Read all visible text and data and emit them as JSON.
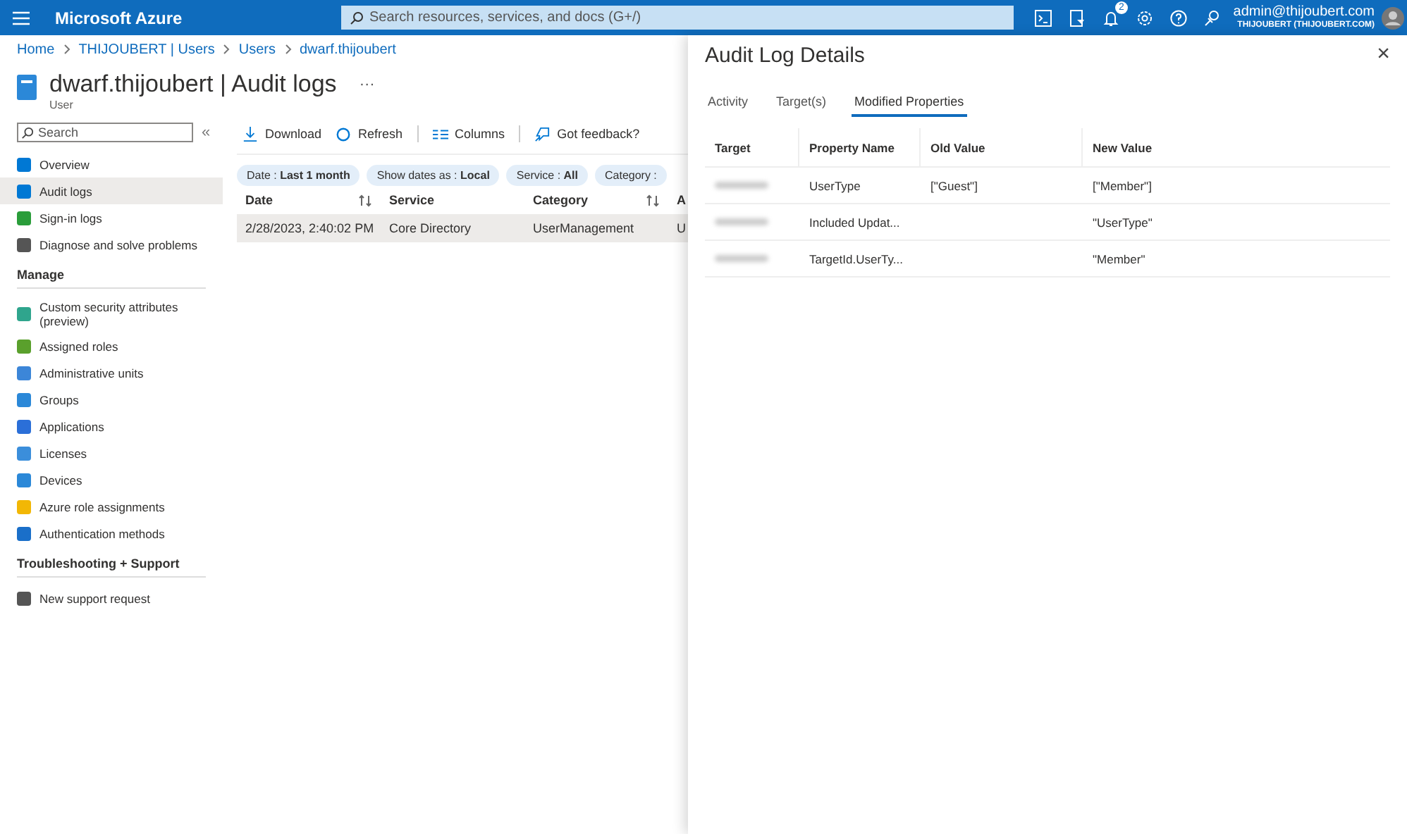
{
  "topbar": {
    "brand": "Microsoft Azure",
    "search": {
      "placeholder": "Search resources, services, and docs (G+/)"
    },
    "notification_count": "2",
    "account": {
      "email": "admin@thijoubert.com",
      "tenant": "THIJOUBERT (THIJOUBERT.COM)"
    }
  },
  "breadcrumb": [
    "Home",
    "THIJOUBERT | Users",
    "Users",
    "dwarf.thijoubert"
  ],
  "page": {
    "title": "dwarf.thijoubert | Audit logs",
    "more": "···",
    "subtitle": "User"
  },
  "sidebar": {
    "search": {
      "placeholder": "Search"
    },
    "collapse": "«",
    "items": [
      {
        "label": "Overview",
        "selected": false
      },
      {
        "label": "Audit logs",
        "selected": true
      },
      {
        "label": "Sign-in logs",
        "selected": false
      },
      {
        "label": "Diagnose and solve problems",
        "selected": false
      }
    ],
    "sections": [
      {
        "title": "Manage",
        "items": [
          {
            "label": "Custom security attributes (preview)",
            "selected": false
          },
          {
            "label": "Assigned roles",
            "selected": false
          },
          {
            "label": "Administrative units",
            "selected": false
          },
          {
            "label": "Groups",
            "selected": false
          },
          {
            "label": "Applications",
            "selected": false
          },
          {
            "label": "Licenses",
            "selected": false
          },
          {
            "label": "Devices",
            "selected": false
          },
          {
            "label": "Azure role assignments",
            "selected": false
          },
          {
            "label": "Authentication methods",
            "selected": false
          }
        ]
      },
      {
        "title": "Troubleshooting + Support",
        "items": [
          {
            "label": "New support request",
            "selected": false
          }
        ]
      }
    ]
  },
  "toolbar": [
    "Download",
    "Refresh",
    "Columns",
    "Got feedback?"
  ],
  "filters": [
    {
      "name": "Date :",
      "value": "Last 1 month"
    },
    {
      "name": "Show dates as :",
      "value": "Local"
    },
    {
      "name": "Service :",
      "value": "All"
    },
    {
      "name": "Category :"
    }
  ],
  "table": {
    "columns": [
      {
        "label": "Date",
        "sortable": true
      },
      {
        "label": "Service",
        "sortable": false
      },
      {
        "label": "Category",
        "sortable": true
      },
      {
        "label": "A"
      }
    ],
    "rows": [
      {
        "cells": [
          "2/28/2023, 2:40:02 PM",
          "Core Directory",
          "UserManagement",
          "U"
        ],
        "selected": true
      }
    ]
  },
  "details": {
    "title": "Audit Log Details",
    "close": "×",
    "tabs": [
      {
        "label": "Activity",
        "selected": false
      },
      {
        "label": "Target(s)",
        "selected": false
      },
      {
        "label": "Modified Properties",
        "selected": true
      }
    ],
    "columns": [
      "Target",
      "Property Name",
      "Old Value",
      "New Value"
    ],
    "rows": [
      {
        "target_blurred": true,
        "property": "UserType",
        "old": "[\"Guest\"]",
        "new": "[\"Member\"]"
      },
      {
        "target_blurred": true,
        "property": "Included Updat...",
        "new": "\"UserType\""
      },
      {
        "target_blurred": true,
        "property": "TargetId.UserTy...",
        "new": "\"Member\""
      }
    ]
  }
}
